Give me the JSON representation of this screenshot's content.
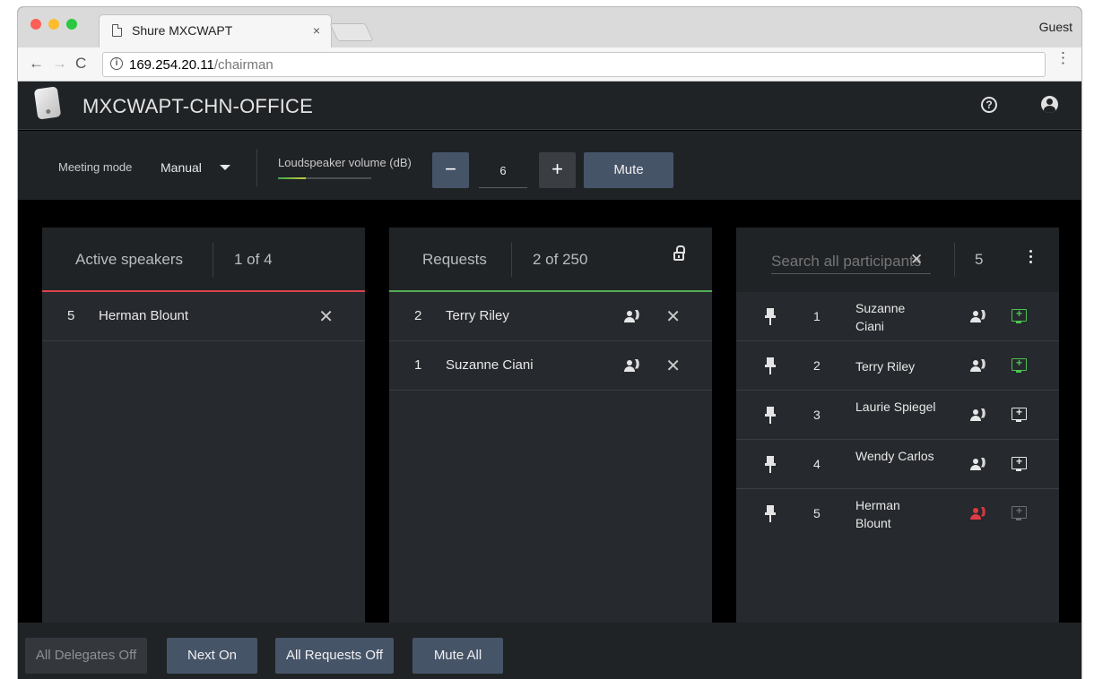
{
  "browser": {
    "tab_title": "Shure MXCWAPT",
    "tab_close": "×",
    "profile": "Guest",
    "url_host": "169.254.20.11",
    "url_path": "/chairman",
    "info_glyph": "i",
    "back_glyph": "←",
    "forward_glyph": "→",
    "reload_glyph": "C",
    "menu_glyph": "⋮"
  },
  "header": {
    "title": "MXCWAPT-CHN-OFFICE",
    "help_glyph": "?"
  },
  "controls": {
    "meeting_mode_label": "Meeting mode",
    "meeting_mode_value": "Manual",
    "loudspeaker_label": "Loudspeaker volume (dB)",
    "volume_value": "6",
    "volume_level_fraction": 0.3,
    "minus_glyph": "−",
    "plus_glyph": "+",
    "mute_label": "Mute"
  },
  "active_speakers": {
    "title": "Active speakers",
    "count": "1 of 4",
    "rows": [
      {
        "num": "5",
        "name": "Herman Blount",
        "remove": "✕"
      }
    ]
  },
  "requests": {
    "title": "Requests",
    "count": "2 of 250",
    "rows": [
      {
        "num": "2",
        "name": "Terry Riley",
        "remove": "✕"
      },
      {
        "num": "1",
        "name": "Suzanne Ciani",
        "remove": "✕"
      }
    ]
  },
  "participants": {
    "search_placeholder": "Search all participants",
    "clear_glyph": "✕",
    "count": "5",
    "rows": [
      {
        "num": "1",
        "name": "Suzanne Ciani"
      },
      {
        "num": "2",
        "name": "Terry Riley"
      },
      {
        "num": "3",
        "name": "Laurie Spiegel"
      },
      {
        "num": "4",
        "name": "Wendy Carlos"
      },
      {
        "num": "5",
        "name": "Herman Blount"
      }
    ]
  },
  "footer": {
    "all_delegates_off": "All Delegates Off",
    "next_on": "Next On",
    "all_requests_off": "All Requests Off",
    "mute_all": "Mute All"
  },
  "colors": {
    "accent_red": "#d9434c",
    "accent_green": "#4fae53",
    "button_blue": "#465468",
    "panel_bg": "#26292d"
  }
}
